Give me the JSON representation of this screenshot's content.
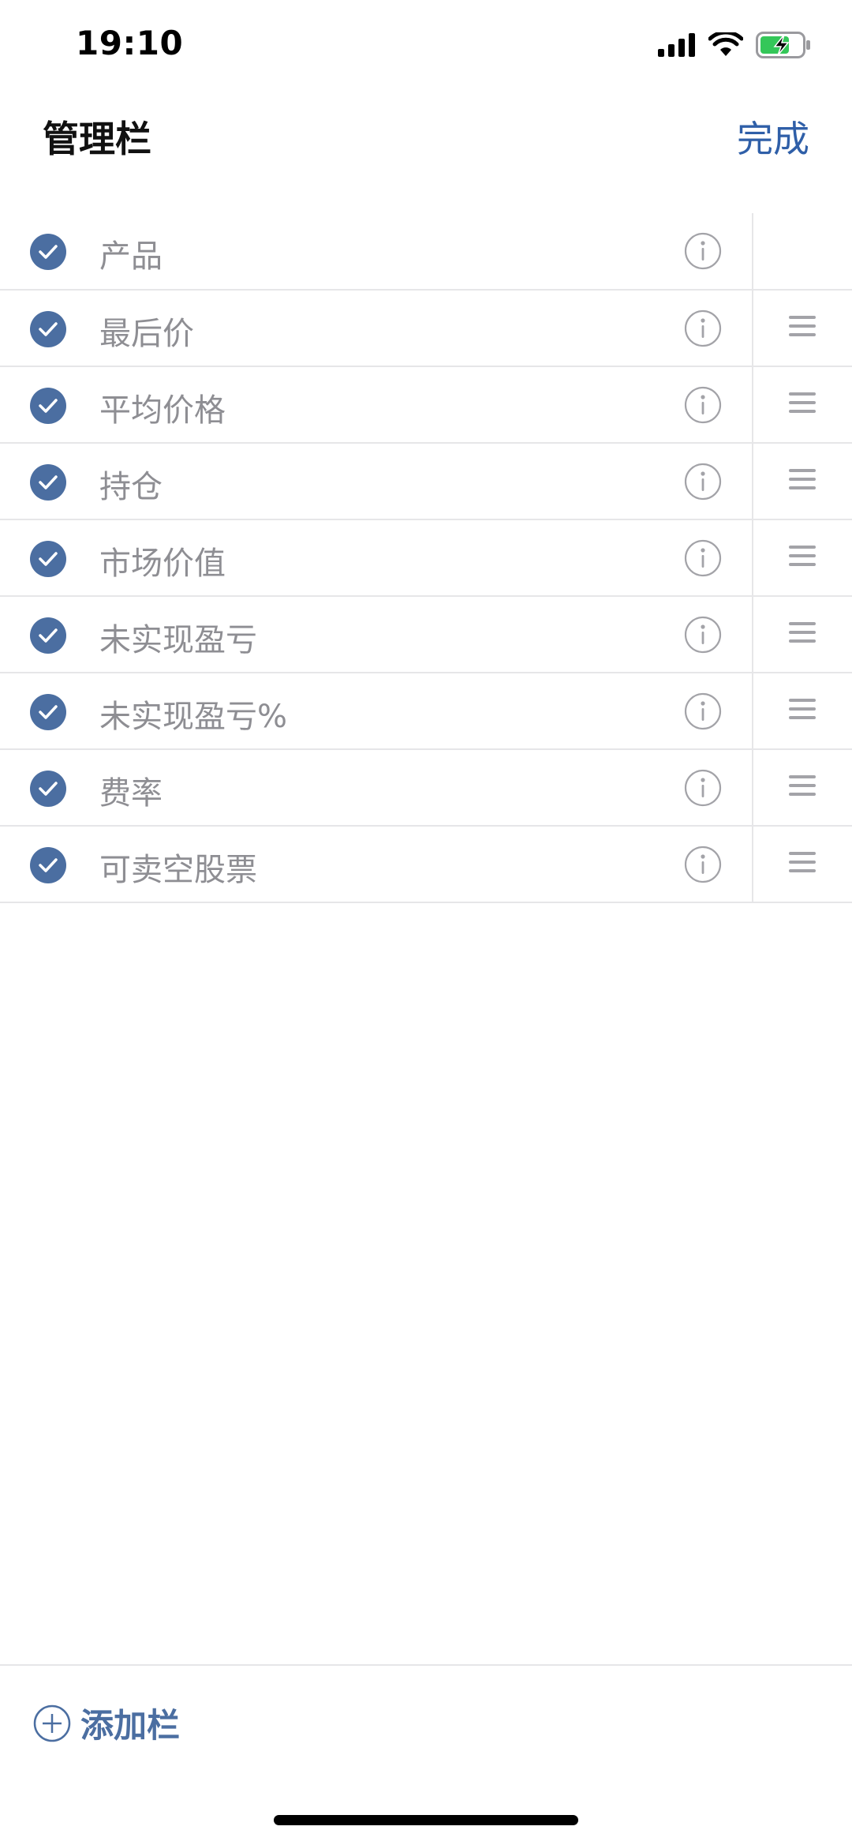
{
  "status_bar": {
    "time": "19:10"
  },
  "header": {
    "title": "管理栏",
    "done_label": "完成"
  },
  "columns": [
    {
      "label": "产品",
      "checked": true,
      "reorderable": false
    },
    {
      "label": "最后价",
      "checked": true,
      "reorderable": true
    },
    {
      "label": "平均价格",
      "checked": true,
      "reorderable": true
    },
    {
      "label": "持仓",
      "checked": true,
      "reorderable": true
    },
    {
      "label": "市场价值",
      "checked": true,
      "reorderable": true
    },
    {
      "label": "未实现盈亏",
      "checked": true,
      "reorderable": true
    },
    {
      "label": "未实现盈亏%",
      "checked": true,
      "reorderable": true
    },
    {
      "label": "费率",
      "checked": true,
      "reorderable": true
    },
    {
      "label": "可卖空股票",
      "checked": true,
      "reorderable": true
    }
  ],
  "footer": {
    "add_column_label": "添加栏"
  },
  "colors": {
    "accent": "#4b6ea1",
    "link": "#2f5fa8",
    "battery_charging": "#34c759"
  }
}
